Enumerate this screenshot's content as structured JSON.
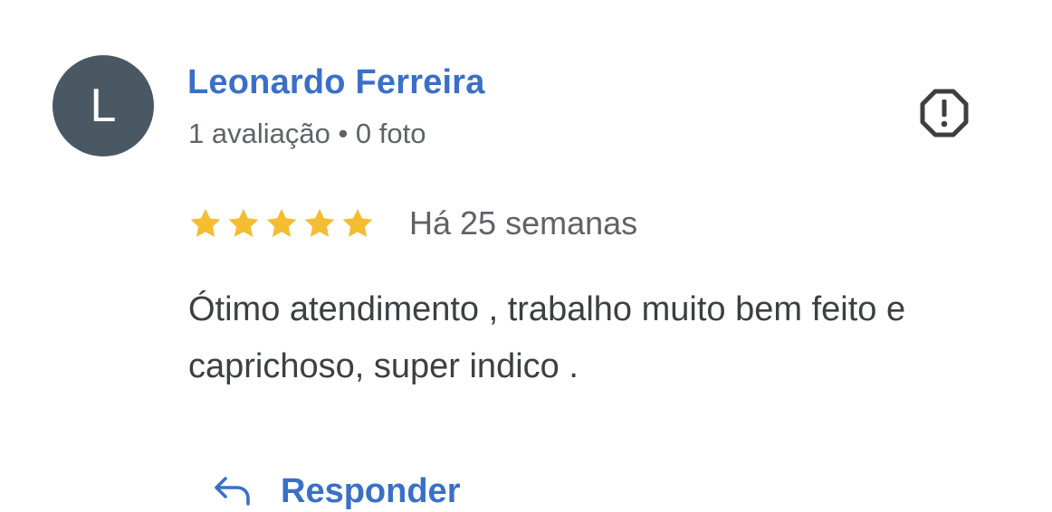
{
  "review": {
    "author": {
      "avatar_letter": "L",
      "avatar_color": "#4a5863",
      "name": "Leonardo Ferreira",
      "meta": "1 avaliação • 0 foto"
    },
    "rating": {
      "stars": 5,
      "max_stars": 5,
      "star_color": "#f5bd33"
    },
    "time_ago": "Há 25 semanas",
    "text": "Ótimo atendimento , trabalho muito bem feito e caprichoso, super indico .",
    "actions": {
      "report_icon": "report-flag-icon",
      "reply_icon": "reply-arrow-icon",
      "reply_label": "Responder"
    },
    "accent_color": "#3a6fc9"
  }
}
